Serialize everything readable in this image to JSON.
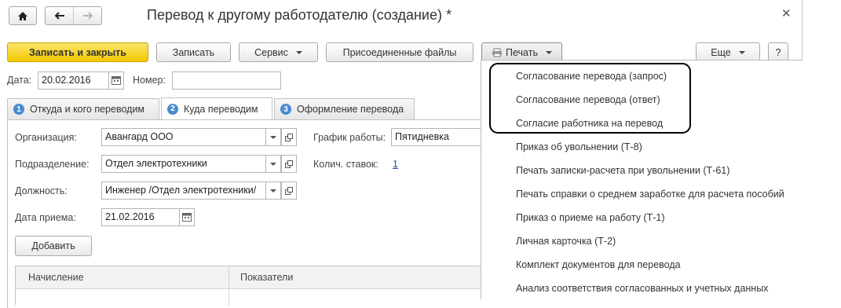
{
  "title": "Перевод к другому работодателю (создание) *",
  "toolbar": {
    "save_close": "Записать и закрыть",
    "save": "Записать",
    "service": "Сервис",
    "attached": "Присоединенные файлы",
    "print": "Печать",
    "more": "Еще",
    "help": "?"
  },
  "header": {
    "date_label": "Дата:",
    "date_value": "20.02.2016",
    "number_label": "Номер:",
    "number_value": ""
  },
  "tabs": [
    {
      "num": "1",
      "label": "Откуда и кого переводим"
    },
    {
      "num": "2",
      "label": "Куда переводим"
    },
    {
      "num": "3",
      "label": "Оформление перевода"
    }
  ],
  "form": {
    "org_label": "Организация:",
    "org_value": "Авангард ООО",
    "dept_label": "Подразделение:",
    "dept_value": "Отдел электротехники",
    "pos_label": "Должность:",
    "pos_value": "Инженер /Отдел электротехники/",
    "hire_label": "Дата приема:",
    "hire_value": "21.02.2016",
    "schedule_label": "График работы:",
    "schedule_value": "Пятидневка",
    "rates_label": "Колич. ставок:",
    "rates_value": "1",
    "add_button": "Добавить"
  },
  "table": {
    "col1": "Начисление",
    "col2": "Показатели"
  },
  "print_menu": [
    "Согласование перевода (запрос)",
    "Согласование перевода (ответ)",
    "Согласие работника на перевод",
    "Приказ об увольнении (Т-8)",
    "Печать записки-расчета при увольнении (Т-61)",
    "Печать справки о среднем заработке для расчета пособий",
    "Приказ о приеме на работу (Т-1)",
    "Личная карточка (Т-2)",
    "Комплект документов для перевода",
    "Анализ соответствия согласованных и учетных данных"
  ],
  "colors": {
    "primary_button": "#f2c800",
    "tab_number": "#4a8bd1",
    "link": "#1a4fa8",
    "highlight_frame": "#000000"
  }
}
